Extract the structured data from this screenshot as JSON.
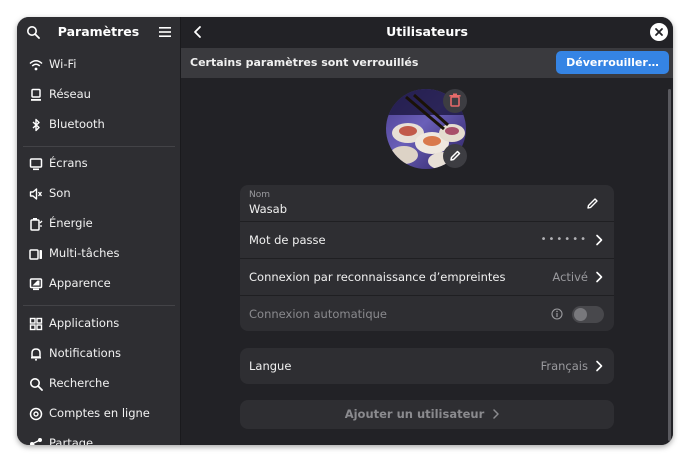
{
  "sidebar": {
    "title": "Paramètres",
    "items": [
      {
        "label": "Wi-Fi",
        "icon": "wifi-icon"
      },
      {
        "label": "Réseau",
        "icon": "network-icon"
      },
      {
        "label": "Bluetooth",
        "icon": "bluetooth-icon"
      },
      {
        "label": "Écrans",
        "icon": "display-icon"
      },
      {
        "label": "Son",
        "icon": "sound-icon"
      },
      {
        "label": "Énergie",
        "icon": "power-icon"
      },
      {
        "label": "Multi-tâches",
        "icon": "multitasking-icon"
      },
      {
        "label": "Apparence",
        "icon": "appearance-icon"
      },
      {
        "label": "Applications",
        "icon": "apps-icon"
      },
      {
        "label": "Notifications",
        "icon": "bell-icon"
      },
      {
        "label": "Recherche",
        "icon": "search-icon"
      },
      {
        "label": "Comptes en ligne",
        "icon": "online-accounts-icon"
      },
      {
        "label": "Partage",
        "icon": "share-icon"
      }
    ]
  },
  "main": {
    "title": "Utilisateurs",
    "banner": {
      "text": "Certains paramètres sont verrouillés",
      "unlock_label": "Déverrouiller…"
    },
    "account": {
      "name_label": "Nom",
      "name_value": "Wasab",
      "password_label": "Mot de passe",
      "password_value": "••••••",
      "fingerprint_label": "Connexion par reconnaissance d’empreintes",
      "fingerprint_value": "Activé",
      "autologin_label": "Connexion automatique",
      "autologin_on": false
    },
    "language": {
      "label": "Langue",
      "value": "Français"
    },
    "add_user_label": "Ajouter un utilisateur"
  },
  "colors": {
    "accent": "#3584e4",
    "delete": "#e66a6a",
    "window_bg": "#222226",
    "sidebar_bg": "#2e2e32"
  }
}
